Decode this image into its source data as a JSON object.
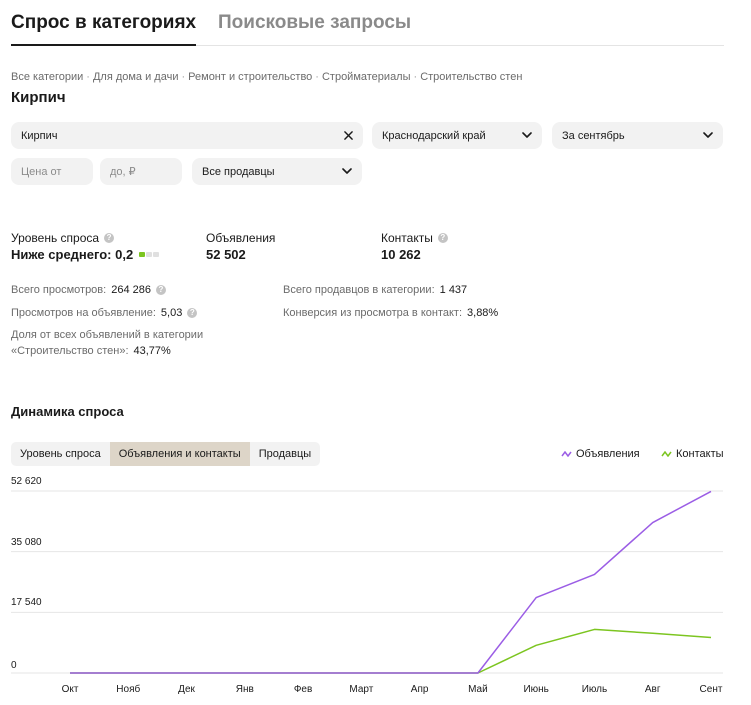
{
  "tabs": [
    {
      "label": "Спрос в категориях",
      "active": true
    },
    {
      "label": "Поисковые запросы",
      "active": false
    }
  ],
  "breadcrumbs": [
    "Все категории",
    "Для дома и дачи",
    "Ремонт и строительство",
    "Стройматериалы",
    "Строительство стен"
  ],
  "breadcrumb_separator": "·",
  "page_title": "Кирпич",
  "filters": {
    "query": {
      "value": "Кирпич",
      "icon": "close-icon"
    },
    "region": {
      "value": "Краснодарский край",
      "icon": "chevron-down-icon"
    },
    "period": {
      "value": "За сентябрь",
      "icon": "chevron-down-icon"
    },
    "price_from": {
      "placeholder": "Цена от"
    },
    "price_to": {
      "placeholder": "до, ₽"
    },
    "sellers": {
      "value": "Все продавцы",
      "icon": "chevron-down-icon"
    }
  },
  "metrics": {
    "demand": {
      "label": "Уровень спроса",
      "value": "Ниже среднего: 0,2",
      "level_active": 1,
      "level_total": 3
    },
    "ads": {
      "label": "Объявления",
      "value": "52 502"
    },
    "contacts": {
      "label": "Контакты",
      "value": "10 262"
    }
  },
  "stats": {
    "total_views": {
      "label": "Всего просмотров:",
      "value": "264 286"
    },
    "sellers_in_category": {
      "label": "Всего продавцов в категории:",
      "value": "1 437"
    },
    "views_per_ad": {
      "label": "Просмотров на объявление:",
      "value": "5,03"
    },
    "conversion": {
      "label": "Конверсия из просмотра в контакт:",
      "value": "3,88%"
    },
    "share_line1": "Доля от всех объявлений в категории",
    "share_line2": "«Строительство стен»:",
    "share_value": "43,77%"
  },
  "dynamics": {
    "title": "Динамика спроса",
    "segments": [
      {
        "label": "Уровень спроса",
        "active": false
      },
      {
        "label": "Объявления и контакты",
        "active": true
      },
      {
        "label": "Продавцы",
        "active": false
      }
    ]
  },
  "colors": {
    "ads_series": "#9b5de5",
    "contacts_series": "#7cc520",
    "grid": "#e6e6e6"
  },
  "chart_data": {
    "type": "line",
    "x": [
      "Окт",
      "Нояб",
      "Дек",
      "Янв",
      "Фев",
      "Март",
      "Апр",
      "Май",
      "Июнь",
      "Июль",
      "Авг",
      "Сент"
    ],
    "y_ticks": [
      "0",
      "17 540",
      "35 080",
      "52 620"
    ],
    "ylim": [
      0,
      52620
    ],
    "grid": true,
    "legend_position": "top-right",
    "series": [
      {
        "name": "Объявления",
        "color": "#9b5de5",
        "values": [
          0,
          0,
          0,
          0,
          0,
          0,
          0,
          0,
          21800,
          28500,
          43500,
          52502
        ]
      },
      {
        "name": "Контакты",
        "color": "#7cc520",
        "values": [
          0,
          0,
          0,
          0,
          0,
          0,
          0,
          0,
          8000,
          12600,
          11500,
          10262
        ]
      }
    ]
  }
}
